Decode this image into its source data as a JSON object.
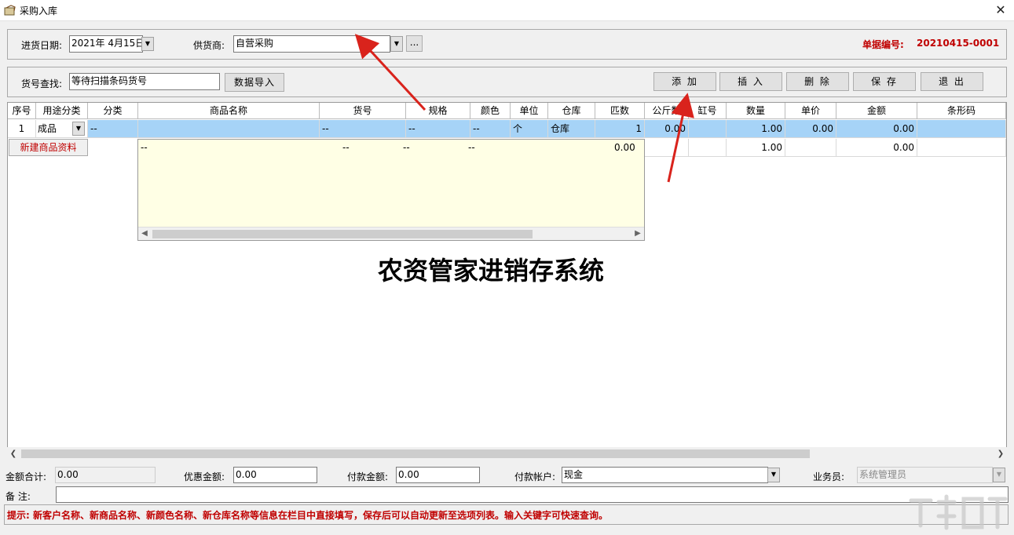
{
  "window": {
    "title": "采购入库",
    "close_glyph": "✕"
  },
  "header": {
    "date_label": "进货日期:",
    "date_value": "2021年  4月15日",
    "supplier_label": "供货商:",
    "supplier_value": "自营采购",
    "more_label": "...",
    "doc_no_label": "单据编号:",
    "doc_no_value": "20210415-0001"
  },
  "search": {
    "label": "货号查找:",
    "value": "等待扫描条码货号",
    "import_button": "数据导入"
  },
  "toolbar": {
    "add": "添 加",
    "insert": "插 入",
    "delete": "删 除",
    "save": "保 存",
    "exit": "退 出"
  },
  "grid": {
    "columns": [
      "序号",
      "用途分类",
      "分类",
      "商品名称",
      "货号",
      "规格",
      "颜色",
      "单位",
      "仓库",
      "匹数",
      "公斤数",
      "缸号",
      "数量",
      "单价",
      "金额",
      "条形码"
    ],
    "rows": [
      {
        "seq": "1",
        "usage": "成品",
        "category": "--",
        "name": "",
        "item_no": "--",
        "spec": "--",
        "color": "--",
        "unit": "个",
        "warehouse": "仓库",
        "pieces": "1",
        "kg": "0.00",
        "vat": "",
        "qty": "1.00",
        "price": "0.00",
        "amount": "0.00",
        "barcode": ""
      },
      {
        "qty": "1.00",
        "amount": "0.00"
      }
    ],
    "new_item_button": "新建商品资料"
  },
  "popup": {
    "name": "--",
    "item_no": "--",
    "spec": "--",
    "color": "--",
    "value": "0.00"
  },
  "watermark": "农资管家进销存系统",
  "footer": {
    "total_label": "金额合计:",
    "total_value": "0.00",
    "discount_label": "优惠金额:",
    "discount_value": "0.00",
    "paid_label": "付款金额:",
    "paid_value": "0.00",
    "account_label": "付款帐户:",
    "account_value": "现金",
    "staff_label": "业务员:",
    "staff_value": "系统管理员",
    "remark_label": "备    注:",
    "remark_value": ""
  },
  "tip": "提示: 新客户名称、新商品名称、新颜色名称、新仓库名称等信息在栏目中直接填写，保存后可以自动更新至选项列表。输入关键字可快速查询。",
  "colors": {
    "accent_red": "#c00000",
    "selected_row": "#a6d3f7",
    "popup_bg": "#ffffe5",
    "arrow": "#d9231c"
  }
}
